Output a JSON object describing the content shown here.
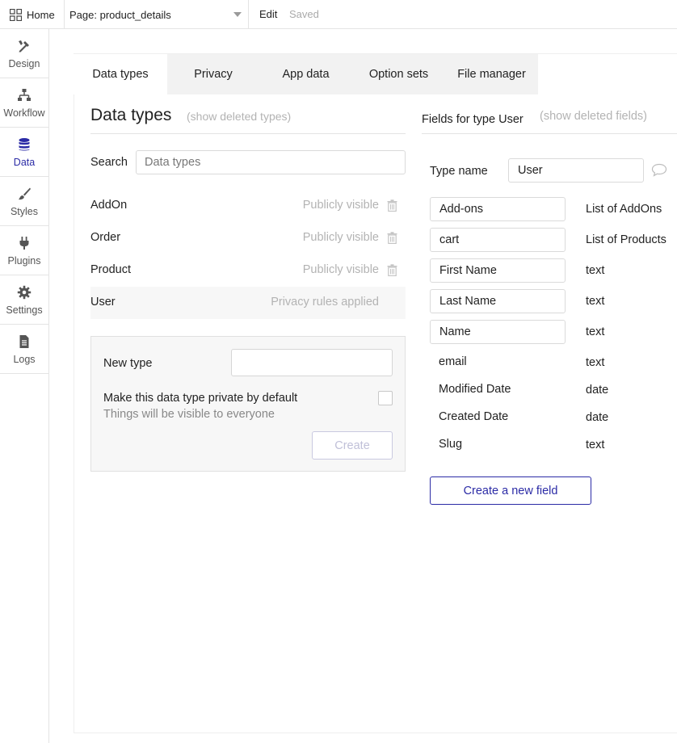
{
  "topbar": {
    "home_label": "Home",
    "page_label": "Page: product_details",
    "edit_label": "Edit",
    "saved_label": "Saved"
  },
  "sidebar": {
    "items": [
      {
        "label": "Design",
        "icon": "design-icon"
      },
      {
        "label": "Workflow",
        "icon": "workflow-icon"
      },
      {
        "label": "Data",
        "icon": "database-icon",
        "active": true
      },
      {
        "label": "Styles",
        "icon": "brush-icon"
      },
      {
        "label": "Plugins",
        "icon": "plug-icon"
      },
      {
        "label": "Settings",
        "icon": "gear-icon"
      },
      {
        "label": "Logs",
        "icon": "document-icon"
      }
    ],
    "active_color": "#2b2ba6"
  },
  "tabs": [
    "Data types",
    "Privacy",
    "App data",
    "Option sets",
    "File manager"
  ],
  "data_types": {
    "title": "Data types",
    "show_deleted": "(show deleted types)",
    "search_label": "Search",
    "search_placeholder": "Data types",
    "types": [
      {
        "name": "AddOn",
        "visibility": "Publicly visible"
      },
      {
        "name": "Order",
        "visibility": "Publicly visible"
      },
      {
        "name": "Product",
        "visibility": "Publicly visible"
      },
      {
        "name": "User",
        "visibility": "Privacy rules applied"
      }
    ],
    "new_type": {
      "label": "New type",
      "private_label": "Make this data type private by default",
      "private_sub": "Things will be visible to everyone",
      "create_label": "Create"
    }
  },
  "fields": {
    "title": "Fields for type User",
    "show_deleted": "(show deleted fields)",
    "type_name_label": "Type name",
    "type_name_value": "User",
    "list": [
      {
        "name": "Add-ons",
        "type": "List of AddOns"
      },
      {
        "name": "cart",
        "type": "List of Products"
      },
      {
        "name": "First Name",
        "type": "text"
      },
      {
        "name": "Last Name",
        "type": "text"
      },
      {
        "name": "Name",
        "type": "text"
      },
      {
        "name": "email",
        "type": "text"
      },
      {
        "name": "Modified Date",
        "type": "date"
      },
      {
        "name": "Created Date",
        "type": "date"
      },
      {
        "name": "Slug",
        "type": "text"
      }
    ],
    "new_field_label": "Create a new field",
    "accent_color": "#2b2ba6"
  }
}
